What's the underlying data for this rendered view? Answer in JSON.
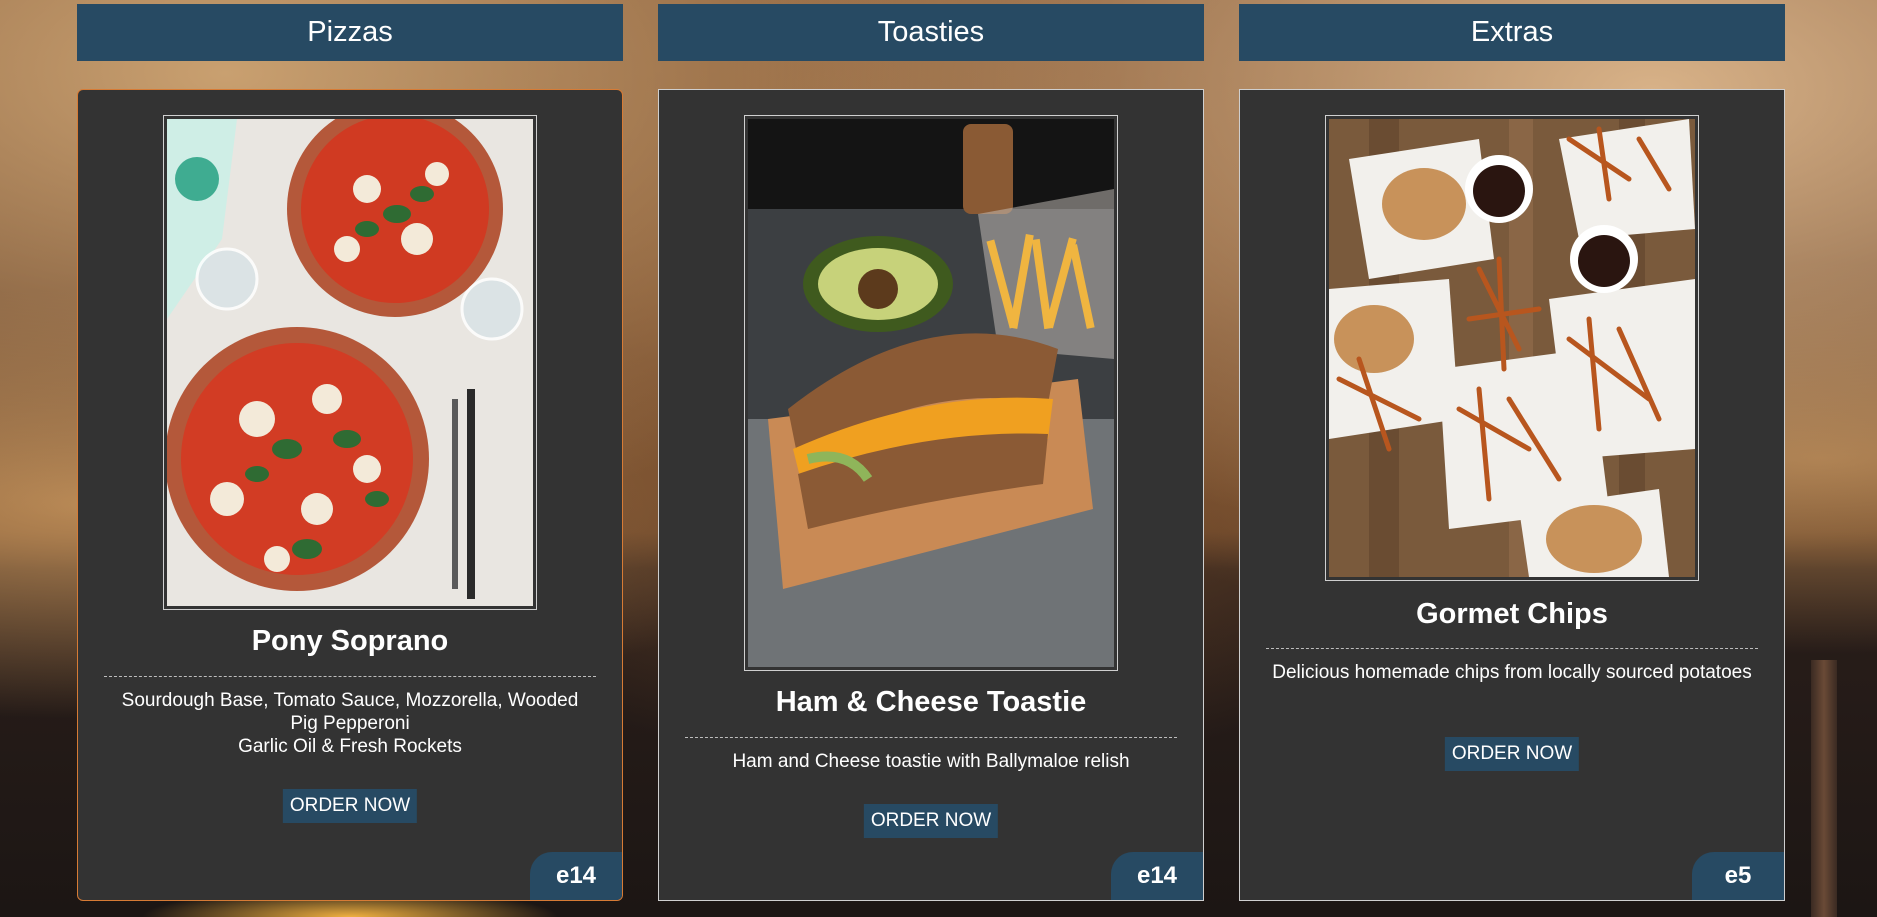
{
  "columns": [
    {
      "category": "Pizzas",
      "item": {
        "name": "Pony Soprano",
        "description_lines": [
          "Sourdough Base, Tomato Sauce, Mozzorella, Wooded Pig Pepperoni",
          "Garlic Oil & Fresh Rockets"
        ],
        "button_label": "ORDER NOW",
        "price": "e14",
        "image_icon": "pizza-photo"
      }
    },
    {
      "category": "Toasties",
      "item": {
        "name": "Ham & Cheese Toastie",
        "description_lines": [
          "Ham and Cheese toastie with Ballymaloe relish"
        ],
        "button_label": "ORDER NOW",
        "price": "e14",
        "image_icon": "toastie-photo"
      }
    },
    {
      "category": "Extras",
      "item": {
        "name": "Gormet Chips",
        "description_lines": [
          "Delicious homemade chips from locally sourced potatoes"
        ],
        "button_label": "ORDER NOW",
        "price": "e5",
        "image_icon": "chips-photo"
      }
    }
  ],
  "colors": {
    "header_bg": "#274a63",
    "card_bg": "#333333",
    "active_card_border": "#d77b35"
  }
}
